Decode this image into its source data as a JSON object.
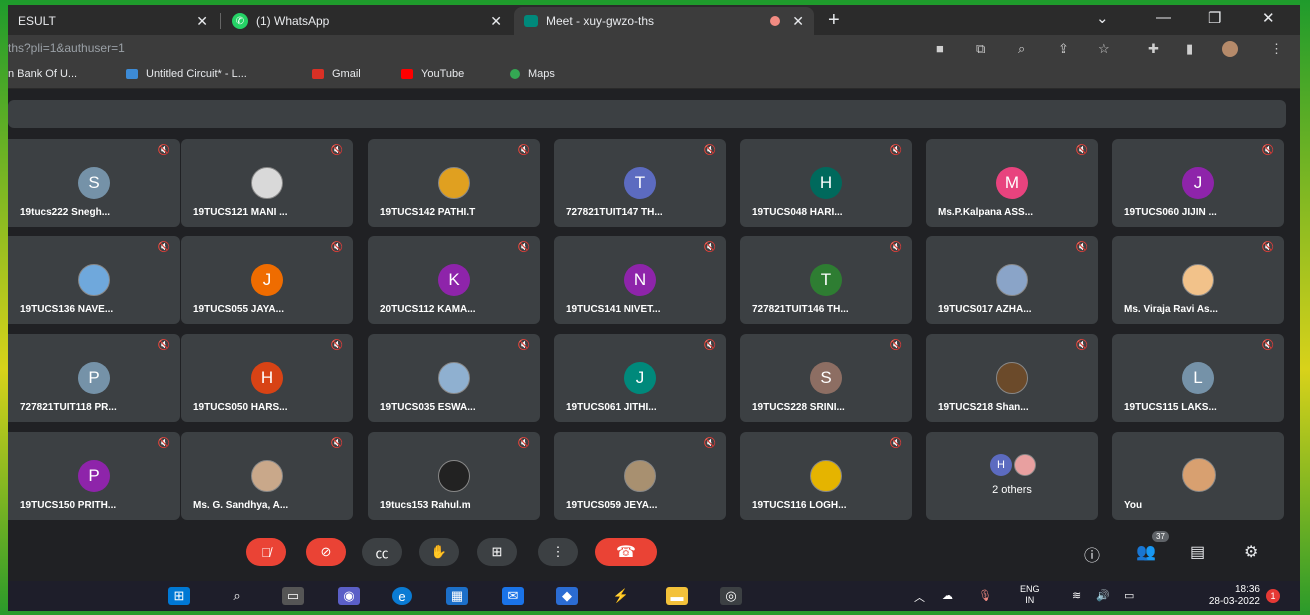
{
  "browser": {
    "tabs": [
      {
        "label": "ESULT",
        "active": false
      },
      {
        "label": "(1) WhatsApp",
        "active": false
      },
      {
        "label": "Meet - xuy-gwzo-ths",
        "active": true
      }
    ],
    "url": "ths?pli=1&authuser=1",
    "bookmarks": [
      {
        "label": "n Bank Of U...",
        "color": "#c58b2a"
      },
      {
        "label": "Untitled Circuit* - L...",
        "color": "#3d8bd6"
      },
      {
        "label": "Gmail",
        "color": "#d93025"
      },
      {
        "label": "YouTube",
        "color": "#ff0000"
      },
      {
        "label": "Maps",
        "color": "#34a853"
      }
    ]
  },
  "participants": [
    {
      "name": "19tucs222 Snegh...",
      "initial": "S",
      "color": "#7592a8",
      "photo": false
    },
    {
      "name": "19TUCS121 MANI ...",
      "initial": "",
      "color": "#d9d9d9",
      "photo": true
    },
    {
      "name": "19TUCS142 PATHI.T",
      "initial": "",
      "color": "#e0a020",
      "photo": true
    },
    {
      "name": "727821TUIT147 TH...",
      "initial": "T",
      "color": "#5c6bc0",
      "photo": false
    },
    {
      "name": "19TUCS048 HARI...",
      "initial": "H",
      "color": "#00695c",
      "photo": false
    },
    {
      "name": "Ms.P.Kalpana ASS...",
      "initial": "M",
      "color": "#e8437e",
      "photo": false
    },
    {
      "name": "19TUCS060 JIJIN ...",
      "initial": "J",
      "color": "#8e24aa",
      "photo": false
    },
    {
      "name": "19TUCS136 NAVE...",
      "initial": "",
      "color": "#6fa8dc",
      "photo": true
    },
    {
      "name": "19TUCS055 JAYA...",
      "initial": "J",
      "color": "#ef6c00",
      "photo": false
    },
    {
      "name": "20TUCS112 KAMA...",
      "initial": "K",
      "color": "#8e24aa",
      "photo": false
    },
    {
      "name": "19TUCS141 NIVET...",
      "initial": "N",
      "color": "#8e24aa",
      "photo": false
    },
    {
      "name": "727821TUIT146 TH...",
      "initial": "T",
      "color": "#2e7d32",
      "photo": false
    },
    {
      "name": "19TUCS017 AZHA...",
      "initial": "",
      "color": "#8aa4c8",
      "photo": true
    },
    {
      "name": "Ms. Viraja Ravi As...",
      "initial": "",
      "color": "#f2c28a",
      "photo": true
    },
    {
      "name": "727821TUIT118 PR...",
      "initial": "P",
      "color": "#7592a8",
      "photo": false
    },
    {
      "name": "19TUCS050 HARS...",
      "initial": "H",
      "color": "#d84315",
      "photo": false
    },
    {
      "name": "19TUCS035 ESWA...",
      "initial": "",
      "color": "#8fb0d0",
      "photo": true
    },
    {
      "name": "19TUCS061 JITHI...",
      "initial": "J",
      "color": "#00897b",
      "photo": false
    },
    {
      "name": "19TUCS228 SRINI...",
      "initial": "S",
      "color": "#8d6e63",
      "photo": false
    },
    {
      "name": "19TUCS218 Shan...",
      "initial": "",
      "color": "#6b4a2a",
      "photo": true
    },
    {
      "name": "19TUCS115 LAKS...",
      "initial": "L",
      "color": "#7592a8",
      "photo": false
    },
    {
      "name": "19TUCS150 PRITH...",
      "initial": "P",
      "color": "#8e24aa",
      "photo": false
    },
    {
      "name": "Ms. G. Sandhya, A...",
      "initial": "",
      "color": "#c9a88a",
      "photo": true
    },
    {
      "name": "19tucs153 Rahul.m",
      "initial": "",
      "color": "#222222",
      "photo": true
    },
    {
      "name": "19TUCS059 JEYA...",
      "initial": "",
      "color": "#a89070",
      "photo": true
    },
    {
      "name": "19TUCS116 LOGH...",
      "initial": "",
      "color": "#e5b400",
      "photo": true
    },
    {
      "name": "2 others",
      "initial": "H",
      "color": "#5c6bc0",
      "photo": false,
      "group": true
    },
    {
      "name": "You",
      "initial": "",
      "color": "#d8a070",
      "photo": true
    }
  ],
  "controls": {
    "participant_count": "37"
  },
  "taskbar": {
    "lang": "ENG",
    "region": "IN",
    "time": "18:36",
    "date": "28-03-2022",
    "notifications": "1"
  }
}
